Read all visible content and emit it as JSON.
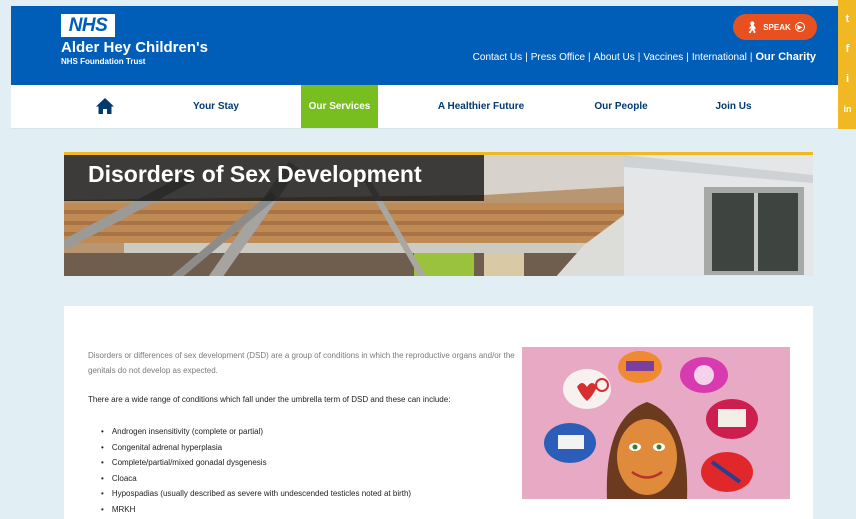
{
  "header": {
    "logo": "NHS",
    "org_name": "Alder Hey Children's",
    "org_sub": "NHS Foundation Trust",
    "speak_label": "SPEAK",
    "links": [
      "Contact Us",
      "Press Office",
      "About Us",
      "Vaccines",
      "International"
    ],
    "separator": "|",
    "charity": "Our Charity"
  },
  "social": [
    "t",
    "f",
    "i",
    "in"
  ],
  "nav": {
    "items": [
      "Your Stay",
      "Our Services",
      "A Healthier Future",
      "Our People",
      "Join Us"
    ],
    "active": "Our Services"
  },
  "hero": {
    "title": "Disorders of Sex Development"
  },
  "content": {
    "intro": "Disorders or differences of sex development (DSD) are a group of conditions in which the reproductive organs and/or the genitals do not develop as expected.",
    "range": "There are a wide range of conditions which fall under the umbrella term of DSD and these can include:",
    "conditions": [
      "Androgen insensitivity (complete or partial)",
      "Congenital adrenal hyperplasia",
      "Complete/partial/mixed gonadal dysgenesis",
      "Cloaca",
      "Hypospadias (usually described as severe with undescended testicles noted at birth)",
      "MRKH"
    ]
  },
  "colors": {
    "nhs_blue": "#005eb8",
    "speak_orange": "#e8511f",
    "active_green": "#78be20",
    "accent_yellow": "#f0b823"
  }
}
